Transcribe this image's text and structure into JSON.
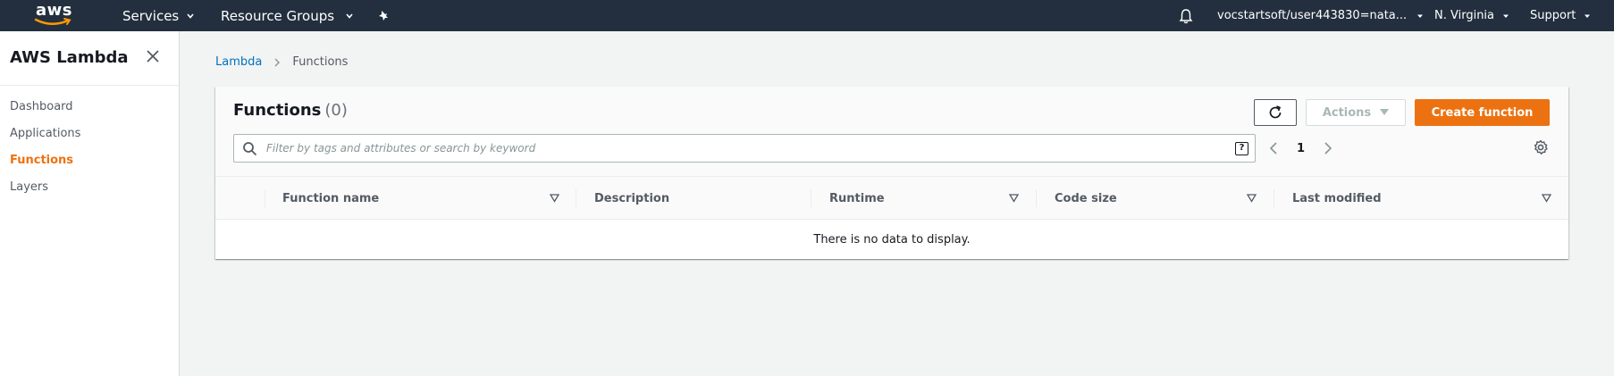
{
  "topnav": {
    "logo_text": "aws",
    "services": "Services",
    "resource_groups": "Resource Groups",
    "account": "vocstartsoft/user443830=nata...",
    "region": "N. Virginia",
    "support": "Support"
  },
  "sidebar": {
    "title": "AWS Lambda",
    "items": [
      {
        "label": "Dashboard",
        "active": false
      },
      {
        "label": "Applications",
        "active": false
      },
      {
        "label": "Functions",
        "active": true
      },
      {
        "label": "Layers",
        "active": false
      }
    ]
  },
  "breadcrumb": {
    "root": "Lambda",
    "current": "Functions"
  },
  "panel": {
    "title": "Functions",
    "count": "(0)",
    "actions_label": "Actions",
    "create_label": "Create function",
    "search_placeholder": "Filter by tags and attributes or search by keyword",
    "help_glyph": "?",
    "page": "1"
  },
  "table": {
    "columns": [
      "Function name",
      "Description",
      "Runtime",
      "Code size",
      "Last modified"
    ],
    "empty_text": "There is no data to display."
  },
  "colors": {
    "nav_bg": "#232f3e",
    "accent": "#ec7211",
    "link": "#0073bb"
  },
  "icons": [
    "bell-icon",
    "pin-icon",
    "close-icon",
    "refresh-icon",
    "search-icon",
    "help-icon",
    "chevron-left-icon",
    "chevron-right-icon",
    "gear-icon",
    "sort-icon"
  ]
}
